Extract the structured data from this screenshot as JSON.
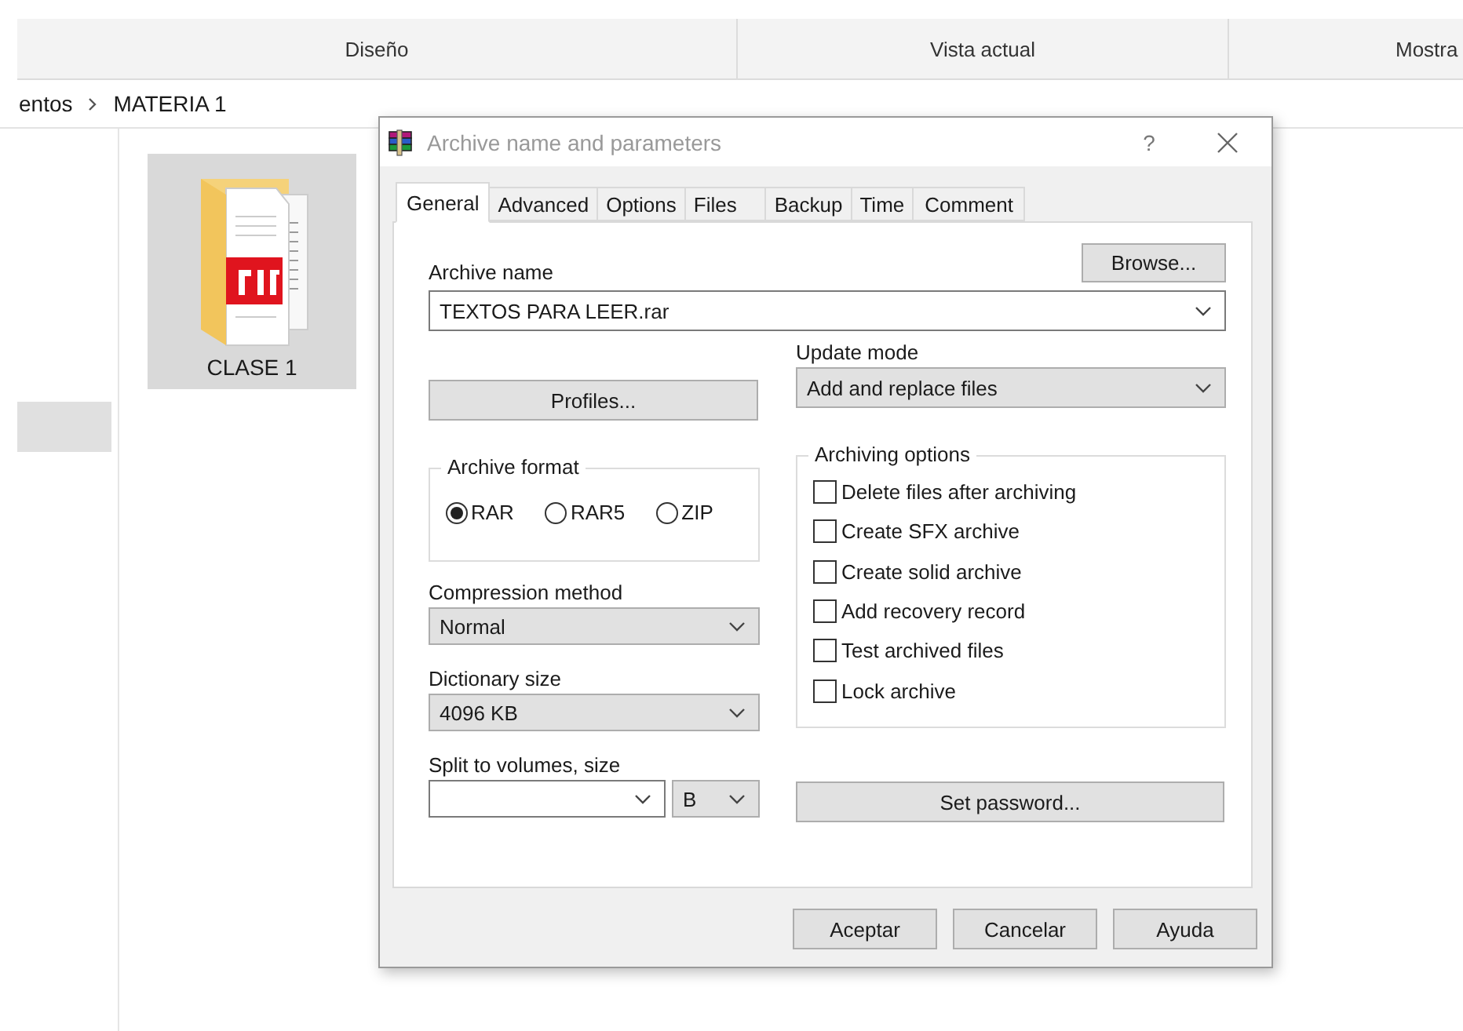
{
  "explorer": {
    "ribbon_groups": [
      "Diseño",
      "Vista actual",
      "Mostra"
    ],
    "breadcrumb": [
      "entos",
      "MATERIA 1"
    ],
    "folder": {
      "label": "CLASE 1",
      "selected": true
    }
  },
  "dialog": {
    "title": "Archive name and parameters",
    "help_button": "?",
    "tabs": [
      {
        "label": "General",
        "selected": true
      },
      {
        "label": "Advanced",
        "selected": false
      },
      {
        "label": "Options",
        "selected": false
      },
      {
        "label": "Files",
        "selected": false
      },
      {
        "label": "Backup",
        "selected": false
      },
      {
        "label": "Time",
        "selected": false
      },
      {
        "label": "Comment",
        "selected": false
      }
    ],
    "archive_name": {
      "label": "Archive name",
      "value": "TEXTOS PARA LEER.rar"
    },
    "browse_button": "Browse...",
    "profiles_button": "Profiles...",
    "update_mode": {
      "label": "Update mode",
      "value": "Add and replace files"
    },
    "archive_format": {
      "label": "Archive format",
      "options": [
        {
          "label": "RAR",
          "selected": true
        },
        {
          "label": "RAR5",
          "selected": false
        },
        {
          "label": "ZIP",
          "selected": false
        }
      ]
    },
    "compression_method": {
      "label": "Compression method",
      "value": "Normal"
    },
    "dictionary_size": {
      "label": "Dictionary size",
      "value": "4096 KB"
    },
    "split_volumes": {
      "label": "Split to volumes, size",
      "unit": "B"
    },
    "archiving_options": {
      "label": "Archiving options",
      "options": [
        {
          "label": "Delete files after archiving",
          "checked": false
        },
        {
          "label": "Create SFX archive",
          "checked": false
        },
        {
          "label": "Create solid archive",
          "checked": false
        },
        {
          "label": "Add recovery record",
          "checked": false
        },
        {
          "label": "Test archived files",
          "checked": false
        },
        {
          "label": "Lock archive",
          "checked": false
        }
      ]
    },
    "set_password_button": "Set password...",
    "buttons": [
      "Aceptar",
      "Cancelar",
      "Ayuda"
    ]
  }
}
